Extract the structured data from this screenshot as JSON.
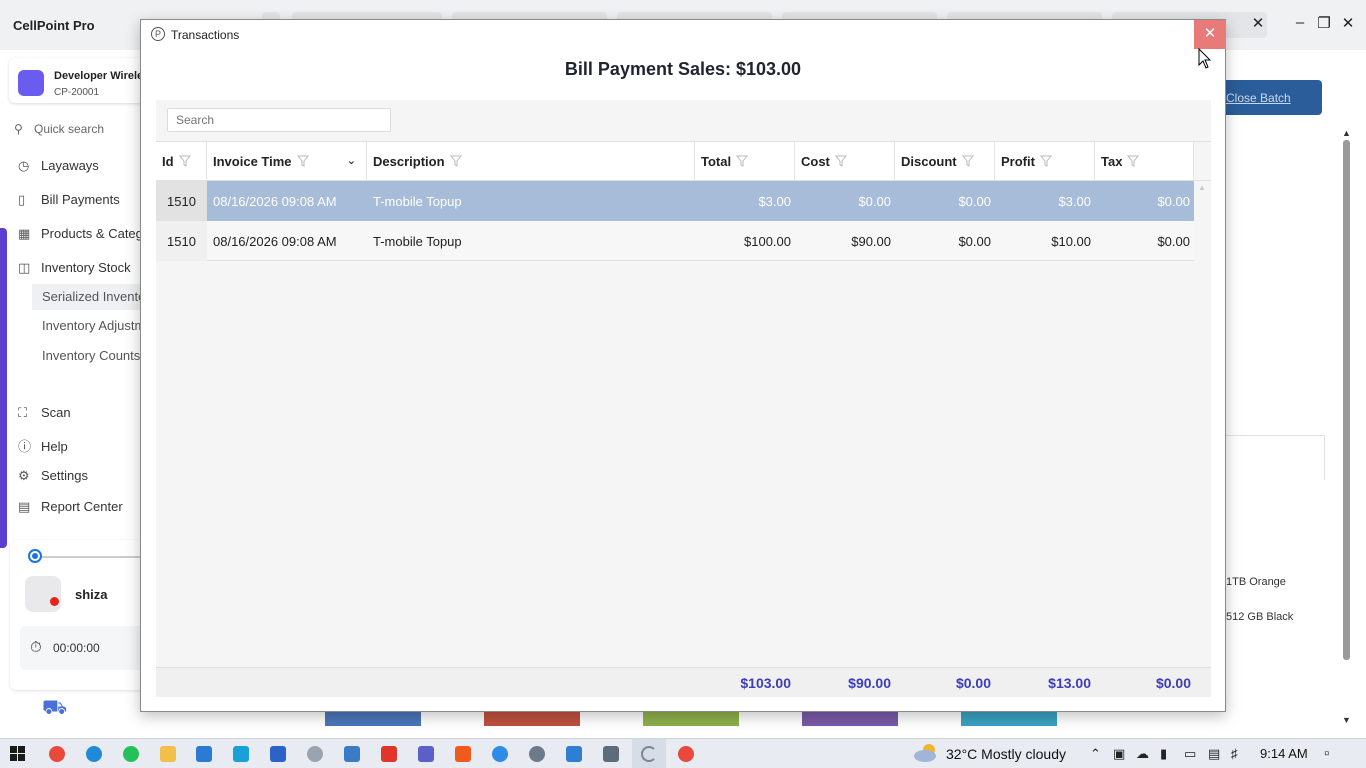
{
  "app": {
    "title": "CellPoint Pro",
    "store": {
      "name": "Developer Wireless",
      "id": "CP-20001"
    },
    "quick_search_placeholder": "Quick search",
    "nav": [
      {
        "label": "Layaways",
        "icon": "layaway-icon"
      },
      {
        "label": "Bill Payments",
        "icon": "bill-icon"
      },
      {
        "label": "Products & Categ",
        "icon": "products-icon"
      },
      {
        "label": "Inventory Stock",
        "icon": "inventory-icon"
      }
    ],
    "nav_sub": [
      "Serialized Invento",
      "Inventory Adjustm",
      "Inventory Counts"
    ],
    "nav_bottom": [
      "Scan",
      "Help",
      "Settings",
      "Report Center"
    ],
    "user": {
      "name": "shiza",
      "timer": "00:00:00"
    },
    "close_batch_label": "Close Batch",
    "right_items": [
      "1TB Orange",
      "512 GB Black"
    ],
    "colors": {
      "accent": "#5a3fd1",
      "brand_button": "#2b5d9a",
      "status_red": "#e0251b"
    }
  },
  "modal": {
    "title": "Transactions",
    "heading": "Bill Payment Sales: $103.00",
    "search_placeholder": "Search",
    "columns": [
      "Id",
      "Invoice Time",
      "Description",
      "Total",
      "Cost",
      "Discount",
      "Profit",
      "Tax"
    ],
    "rows": [
      {
        "id": "1510",
        "invoice_time": "08/16/2026 09:08 AM",
        "description": "T-mobile Topup",
        "total": "$3.00",
        "cost": "$0.00",
        "discount": "$0.00",
        "profit": "$3.00",
        "tax": "$0.00",
        "selected": true
      },
      {
        "id": "1510",
        "invoice_time": "08/16/2026 09:08 AM",
        "description": "T-mobile Topup",
        "total": "$100.00",
        "cost": "$90.00",
        "discount": "$0.00",
        "profit": "$10.00",
        "tax": "$0.00",
        "selected": false
      }
    ],
    "totals": {
      "total": "$103.00",
      "cost": "$90.00",
      "discount": "$0.00",
      "profit": "$13.00",
      "tax": "$0.00"
    }
  },
  "taskbar": {
    "weather": "32°C  Mostly cloudy",
    "time": "9:14 AM"
  }
}
